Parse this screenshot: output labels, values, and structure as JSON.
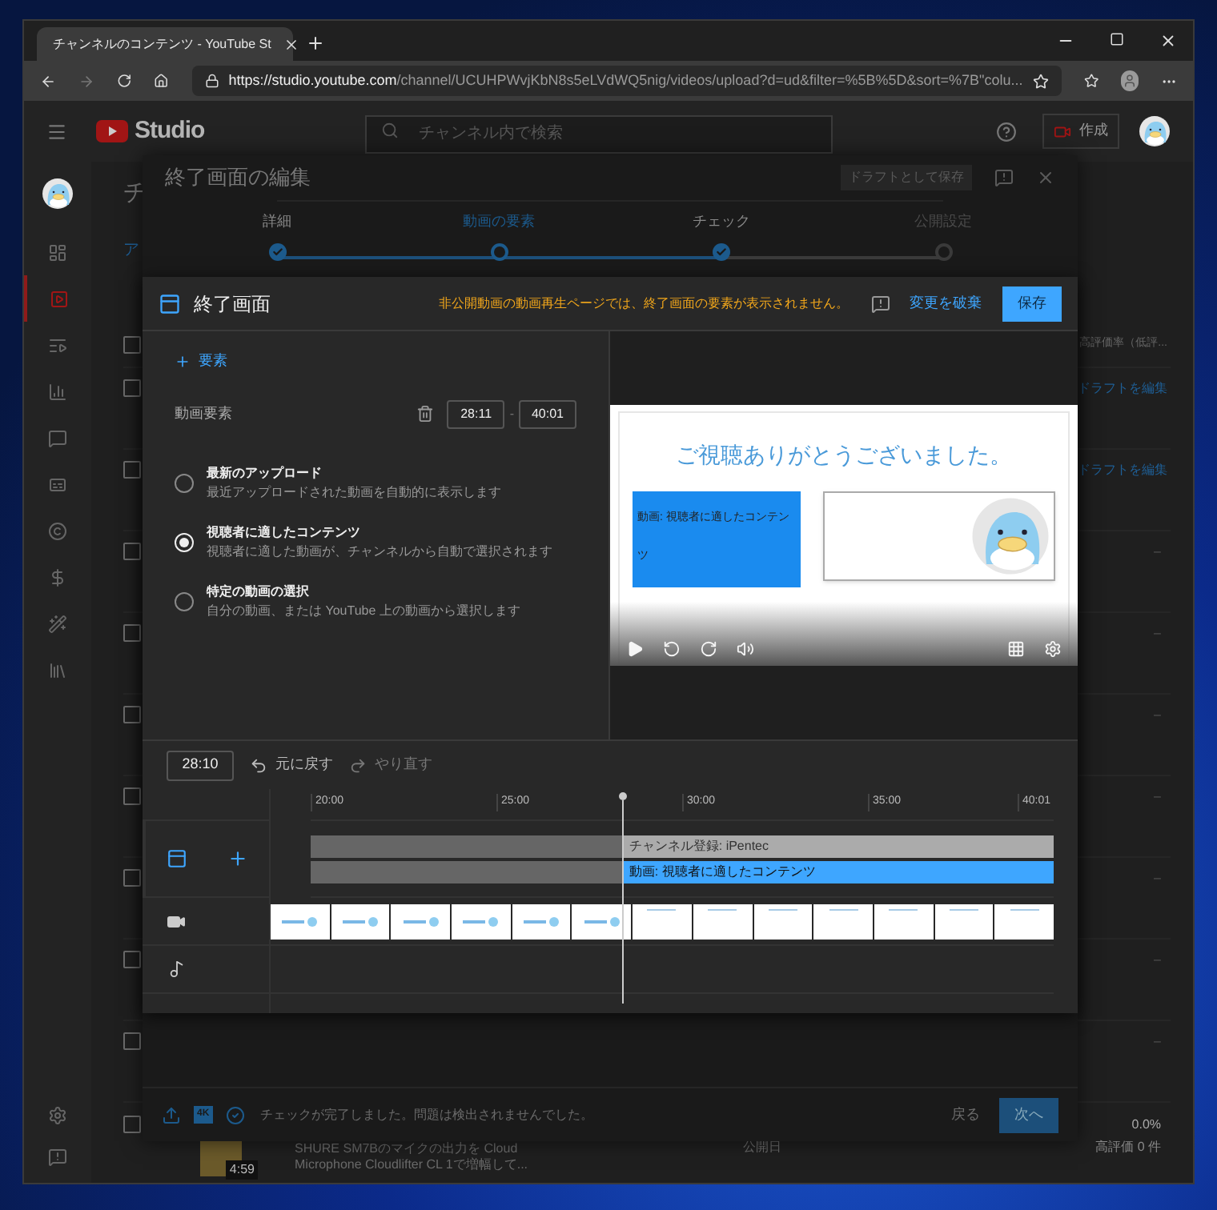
{
  "browser": {
    "tab_title": "チャンネルのコンテンツ - YouTube St",
    "url_host": "https://studio.youtube.com",
    "url_rest": "/channel/UCUHPWvjKbN8s5eLVdWQ5nig/videos/upload?d=ud&filter=%5B%5D&sort=%7B\"colu..."
  },
  "header": {
    "logo": "Studio",
    "search_placeholder": "チャンネル内で検索",
    "create": "作成"
  },
  "sidebar": {
    "items": [
      {
        "selected": false
      },
      {
        "selected": true
      },
      {
        "selected": false
      },
      {
        "selected": false
      },
      {
        "selected": false
      },
      {
        "selected": false
      },
      {
        "selected": false
      },
      {
        "selected": false
      },
      {
        "selected": false
      },
      {
        "selected": false
      }
    ]
  },
  "page": {
    "title": "チ",
    "tab": "ア",
    "column_header": "高評価率（低評...",
    "all_checked": false,
    "rows": [
      {
        "kind": "link",
        "value": "ドラフトを編集",
        "checked": false
      },
      {
        "kind": "link",
        "value": "ドラフトを編集",
        "checked": false
      },
      {
        "kind": "text",
        "value": "–",
        "checked": false
      },
      {
        "kind": "text",
        "value": "–",
        "checked": false
      },
      {
        "kind": "text",
        "value": "–",
        "checked": false
      },
      {
        "kind": "text",
        "value": "–",
        "checked": false
      },
      {
        "kind": "text",
        "value": "–",
        "checked": false
      },
      {
        "kind": "text",
        "value": "–",
        "checked": false
      },
      {
        "kind": "text",
        "value": "–",
        "checked": false
      }
    ],
    "video_row": {
      "checked": false,
      "duration": "4:59",
      "title": "SHURE SM7Bのマイクの出力を Cloud Microphone Cloudlifter CL 1で増幅して...",
      "date_label": "公開日",
      "rating": "0.0%",
      "likes": "高評価 0 件"
    }
  },
  "editor": {
    "title": "終了画面の編集",
    "draft_button": "ドラフトとして保存",
    "steps": [
      {
        "label": "詳細",
        "selected": false,
        "completed": true
      },
      {
        "label": "動画の要素",
        "selected": true,
        "completed": false
      },
      {
        "label": "チェック",
        "selected": false,
        "completed": true
      },
      {
        "label": "公開設定",
        "selected": false,
        "completed": false
      }
    ],
    "footer": {
      "badge": "4K",
      "status": "チェックが完了しました。問題は検出されませんでした。",
      "back": "戻る",
      "next": "次へ"
    }
  },
  "endscreen": {
    "title": "終了画面",
    "warning": "非公開動画の動画再生ページでは、終了画面の要素が表示されません。",
    "discard": "変更を破棄",
    "save": "保存",
    "add_element": "要素",
    "element_label": "動画要素",
    "start": "28:11",
    "separator": "-",
    "end": "40:01",
    "options": [
      {
        "title": "最新のアップロード",
        "description": "最近アップロードされた動画を自動的に表示します",
        "selected": false
      },
      {
        "title": "視聴者に適したコンテンツ",
        "description": "視聴者に適した動画が、チャンネルから自動で選択されます",
        "selected": true
      },
      {
        "title": "特定の動画の選択",
        "description": "自分の動画、または YouTube 上の動画から選択します",
        "selected": false
      }
    ],
    "preview": {
      "heading": "ご視聴ありがとうございました。",
      "element_text": "動画: 視聴者に適したコンテンツ"
    },
    "timeline": {
      "time": "28:10",
      "undo": {
        "label": "元に戻す",
        "disabled": false
      },
      "redo": {
        "label": "やり直す",
        "disabled": true
      },
      "ticks": [
        "20:00",
        "25:00",
        "30:00",
        "35:00",
        "40:01"
      ],
      "playhead": {
        "level": 0.42
      },
      "bars": [
        {
          "kind": "subscribe",
          "label": "チャンネル登録: iPentec"
        },
        {
          "kind": "video",
          "label": "動画: 視聴者に適したコンテンツ"
        }
      ],
      "frames": [
        {
          "kind": "text"
        },
        {
          "kind": "text"
        },
        {
          "kind": "text"
        },
        {
          "kind": "text"
        },
        {
          "kind": "text"
        },
        {
          "kind": "text"
        },
        {
          "kind": "blank"
        },
        {
          "kind": "blank"
        },
        {
          "kind": "blank"
        },
        {
          "kind": "blank"
        },
        {
          "kind": "blank"
        },
        {
          "kind": "blank"
        },
        {
          "kind": "blank"
        }
      ]
    }
  }
}
